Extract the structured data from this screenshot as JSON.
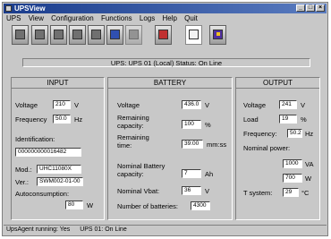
{
  "window": {
    "title": "UPSView"
  },
  "menu": [
    "UPS",
    "View",
    "Configuration",
    "Functions",
    "Logs",
    "Help",
    "Quit"
  ],
  "toolbar": [
    {
      "icon": "ups-gear-icon"
    },
    {
      "icon": "ups-icon"
    },
    {
      "icon": "ups-icon"
    },
    {
      "icon": "ups-icon"
    },
    {
      "icon": "ups-icon"
    },
    {
      "icon": "ups-network-icon"
    },
    {
      "icon": "ups-disabled-icon"
    },
    {
      "icon": "alarm-icon"
    },
    {
      "icon": "document-icon"
    },
    {
      "icon": "book-icon"
    }
  ],
  "status_line": "UPS: UPS 01 (Local)    Status: On Line",
  "input": {
    "title": "INPUT",
    "voltage_label": "Voltage",
    "voltage": "210",
    "voltage_unit": "V",
    "frequency_label": "Frequency",
    "frequency": "50.0",
    "frequency_unit": "Hz",
    "identification_label": "Identification:",
    "identification": "000000000016482",
    "mod_label": "Mod.:",
    "mod": "UHC11080X",
    "ver_label": "Ver.:",
    "ver": "SWM002-01-00",
    "autoconsumption_label": "Autoconsumption:",
    "autoconsumption": "80",
    "autoconsumption_unit": "W"
  },
  "battery": {
    "title": "BATTERY",
    "voltage_label": "Voltage",
    "voltage": "436.0",
    "voltage_unit": "V",
    "remaining_capacity_label_1": "Remaining",
    "remaining_capacity_label_2": "capacity:",
    "remaining_capacity": "100",
    "remaining_capacity_unit": "%",
    "remaining_time_label_1": "Remaining",
    "remaining_time_label_2": "time:",
    "remaining_time": "39:00",
    "remaining_time_unit": "mm:ss",
    "nominal_capacity_label_1": "Nominal Battery",
    "nominal_capacity_label_2": "capacity:",
    "nominal_capacity": "7",
    "nominal_capacity_unit": "Ah",
    "nominal_vbat_label": "Nominal Vbat:",
    "nominal_vbat": "36",
    "nominal_vbat_unit": "V",
    "num_batteries_label": "Number of batteries:",
    "num_batteries": "4300"
  },
  "output": {
    "title": "OUTPUT",
    "voltage_label": "Voltage",
    "voltage": "241",
    "voltage_unit": "V",
    "load_label": "Load",
    "load": "19",
    "load_unit": "%",
    "frequency_label": "Frequency:",
    "frequency": "50.2",
    "frequency_unit": "Hz",
    "nominal_power_label": "Nominal power:",
    "nominal_power_va": "1000",
    "nominal_power_va_unit": "VA",
    "nominal_power_w": "700",
    "nominal_power_w_unit": "W",
    "tsystem_label": "T system:",
    "tsystem": "29",
    "tsystem_unit": "°C"
  },
  "statusbar": {
    "agent": "UpsAgent running: Yes",
    "ups": "UPS 01: On Line"
  }
}
